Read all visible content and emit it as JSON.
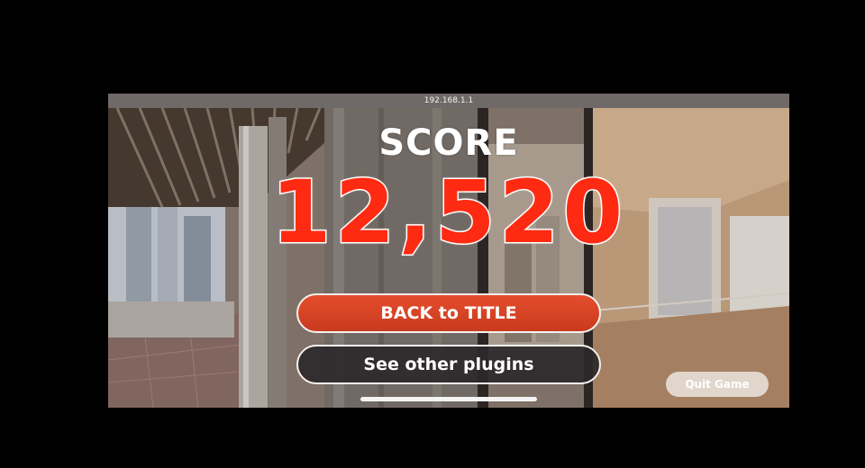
{
  "status_bar": {
    "address": "192.168.1.1"
  },
  "result": {
    "score_label": "SCORE",
    "score_value": "12,520"
  },
  "buttons": {
    "back_to_title": "BACK to TITLE",
    "see_other_plugins": "See other plugins",
    "quit_game": "Quit Game"
  },
  "colors": {
    "score_red": "#ff2a12",
    "primary_button": "#d8442a",
    "secondary_button": "#2d282a"
  }
}
